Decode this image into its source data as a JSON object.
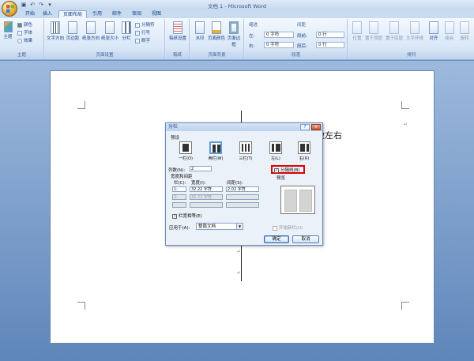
{
  "app": {
    "title": "文档 1 - Microsoft Word"
  },
  "qat": {
    "save_icon": "save-icon",
    "undo_icon": "undo-icon",
    "redo_icon": "redo-icon"
  },
  "tabs": [
    {
      "label": "开始"
    },
    {
      "label": "插入"
    },
    {
      "label": "页面布局"
    },
    {
      "label": "引用"
    },
    {
      "label": "邮件"
    },
    {
      "label": "审阅"
    },
    {
      "label": "视图"
    }
  ],
  "ribbon": {
    "theme": {
      "label": "主题",
      "button": "主题",
      "colors": "颜色",
      "fonts": "字体",
      "effects": "效果"
    },
    "page_setup": {
      "label": "页面设置",
      "text_direction": "文字方向",
      "margins": "页边距",
      "orientation": "纸张方向",
      "size": "纸张大小",
      "columns": "分栏",
      "breaks": "分隔符",
      "line_numbers": "行号",
      "hyphenation": "断字"
    },
    "manuscript": {
      "label": "稿纸",
      "button": "稿纸设置"
    },
    "page_background": {
      "label": "页面背景",
      "watermark": "水印",
      "page_color": "页面颜色",
      "page_borders": "页面边框"
    },
    "paragraph": {
      "label": "段落",
      "indent_header": "缩进",
      "spacing_header": "间距",
      "left_label": "左:",
      "left_value": "0 字符",
      "right_label": "右:",
      "right_value": "0 字符",
      "before_label": "段前:",
      "before_value": "0 行",
      "after_label": "段后:",
      "after_value": "0 行"
    },
    "arrange": {
      "label": "排列",
      "position": "位置",
      "bring_front": "置于顶层",
      "send_back": "置于底层",
      "wrap": "文字环绕",
      "align": "对齐",
      "group": "组合",
      "rotate": "旋转"
    }
  },
  "document": {
    "body_text": "做左右",
    "para_mark": "↵"
  },
  "dialog": {
    "title": "分栏",
    "help": "?",
    "close": "×",
    "presets_label": "预设",
    "presets": [
      {
        "label": "一栏(O)"
      },
      {
        "label": "两栏(W)"
      },
      {
        "label": "三栏(T)"
      },
      {
        "label": "左(L)"
      },
      {
        "label": "右(R)"
      }
    ],
    "num_columns_label": "列数(N):",
    "num_columns_value": "2",
    "line_between_label": "分隔线(B)",
    "line_between_checked": true,
    "width_spacing_label": "宽度和间距",
    "col_header": "栏(C):",
    "width_header": "宽度(I):",
    "spacing_header": "间距(S):",
    "rows": [
      {
        "col": "1:",
        "width": "32.22 字符",
        "spacing": "2.02 字符"
      },
      {
        "col": "2:",
        "width": "32.22 字符",
        "spacing": ""
      },
      {
        "col": "",
        "width": "",
        "spacing": ""
      }
    ],
    "equal_width_label": "栏宽相等(E)",
    "equal_width_checked": true,
    "preview_label": "预览",
    "apply_to_label": "应用于(A):",
    "apply_to_value": "整篇文档",
    "new_column_label": "开始新栏(U)",
    "ok": "确定",
    "cancel": "取消"
  }
}
